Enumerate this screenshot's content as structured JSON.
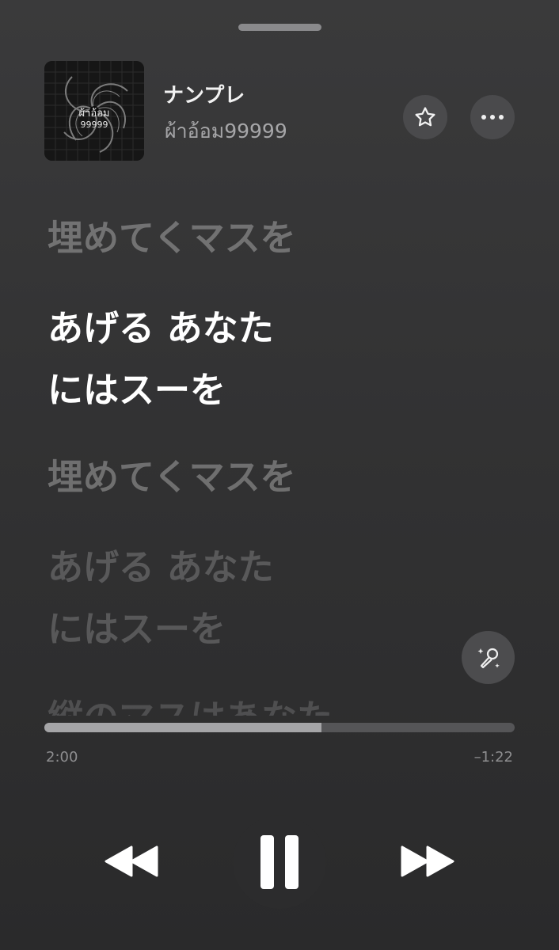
{
  "now_playing": {
    "title": "ナンプレ",
    "artist": "ผ้าอ้อม99999",
    "artwork": {
      "caption_line1": "ผ้าอ้อม",
      "caption_line2": "99999"
    }
  },
  "actions": {
    "favorite_icon": "star-icon",
    "more_icon": "ellipsis-icon",
    "sing_icon": "microphone-sparkle-icon"
  },
  "lyrics": [
    {
      "line": "埋めてくマスを",
      "state": "past"
    },
    {
      "line": "あげる あなた",
      "state": "active"
    },
    {
      "line": "にはスーを",
      "state": "active"
    },
    {
      "line": "埋めてくマスを",
      "state": "upcoming"
    },
    {
      "line": "あげる あなた",
      "state": "upcoming"
    },
    {
      "line": "にはスーを",
      "state": "upcoming"
    },
    {
      "line": "縦のマスはあなた",
      "state": "upcoming"
    }
  ],
  "playback": {
    "elapsed": "2:00",
    "remaining": "–1:22",
    "progress_fraction": 0.59
  },
  "controls": {
    "previous_icon": "rewind-icon",
    "pause_icon": "pause-icon",
    "next_icon": "fast-forward-icon"
  },
  "colors": {
    "background": "#323233",
    "active_lyric": "#ffffff",
    "progress_fill": "#a5a5a7",
    "progress_track": "#555557"
  }
}
